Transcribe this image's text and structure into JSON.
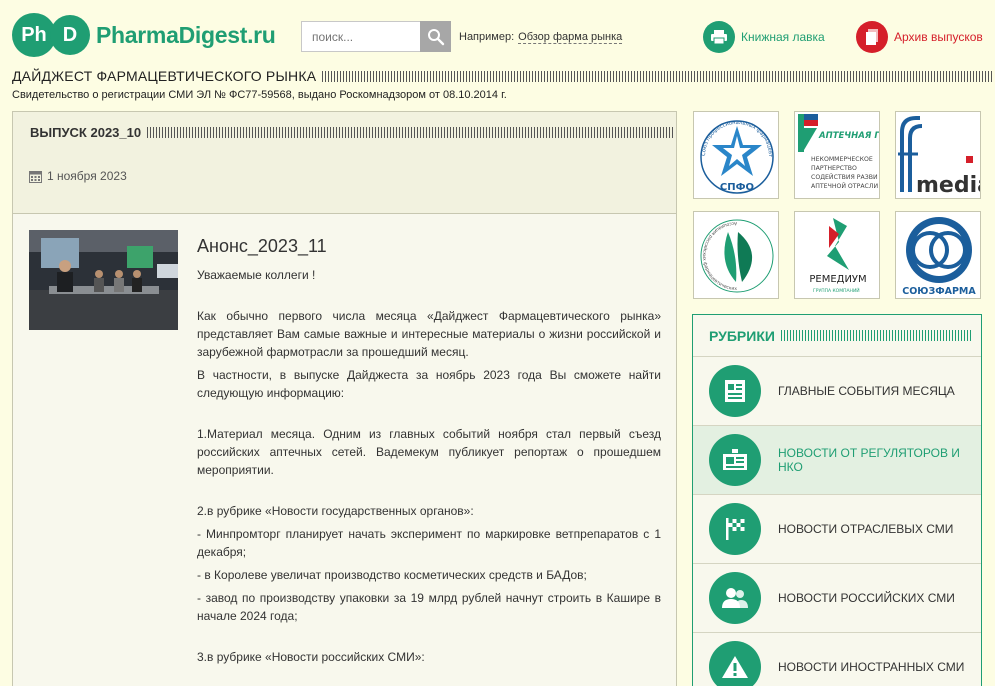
{
  "header": {
    "logo_ph": "Ph",
    "logo_d": "D",
    "site_name": "PharmaDigest.ru",
    "search_placeholder": "поиск...",
    "example_prefix": "Например:",
    "example_link": "Обзор фарма рынка",
    "books_label": "Книжная лавка",
    "archive_label": "Архив выпусков"
  },
  "site": {
    "title": "ДАЙДЖЕСТ ФАРМАЦЕВТИЧЕСКОГО РЫНКА",
    "registration": "Свидетельство о регистрации СМИ ЭЛ № ФС77-59568, выдано Роскомнадзором от 08.10.2014 г."
  },
  "issue": {
    "title": "ВЫПУСК 2023_10",
    "date": "1 ноября 2023"
  },
  "article": {
    "title": "Анонс_2023_11",
    "greeting": "Уважаемые коллеги !",
    "p1": "Как обычно первого числа месяца «Дайджест Фармацевтического рынка» представляет Вам самые важные и интересные материалы о жизни российской и зарубежной фармотрасли за прошедший месяц.",
    "p2": "В частности, в выпуске Дайджеста за ноябрь 2023 года Вы сможете найти следующую информацию:",
    "p3": "1.Материал месяца. Одним из главных событий ноября стал первый съезд российских аптечных сетей. Вадемекум публикует репортаж о прошедшем мероприятии.",
    "p4": "2.в рубрике «Новости государственных органов»:",
    "p5": "- Минпромторг планирует начать эксперимент по маркировке ветпрепаратов с 1 декабря;",
    "p6": "- в Королеве увеличат производство косметических средств и БАДов;",
    "p7": "- завод по производству упаковки за 19 млрд рублей начнут строить в Кашире в начале 2024 года;",
    "p8": "3.в рубрике «Новости российских СМИ»:"
  },
  "partners": {
    "spfo_arc": "Союз профессиональных фармацевтических организаций",
    "spfo_label": "СПФО",
    "guild_title": "АПТЕЧНАЯ ГИЛЬДИЯ",
    "guild_sub1": "НЕКОММЕРЧЕСКОЕ",
    "guild_sub2": "ПАРТНЕРСТВО",
    "guild_sub3": "СОДЕЙСТВИЯ РАЗВИ",
    "guild_sub4": "АПТЕЧНОЙ ОТРАСЛИ",
    "media_label": "media",
    "assoc_arc": "Ассоциация российских фармацевтических производителей",
    "remedium_label": "РЕМЕДИУМ",
    "remedium_sub": "ГРУППА КОМПАНИЙ",
    "soyuz_label": "СОЮЗФАРМА"
  },
  "rubrics": {
    "title": "РУБРИКИ",
    "items": [
      {
        "label": "ГЛАВНЫЕ СОБЫТИЯ МЕСЯЦА"
      },
      {
        "label": "НОВОСТИ ОТ РЕГУЛЯТОРОВ И НКО"
      },
      {
        "label": "НОВОСТИ ОТРАСЛЕВЫХ СМИ"
      },
      {
        "label": "НОВОСТИ РОССИЙСКИХ СМИ"
      },
      {
        "label": "НОВОСТИ ИНОСТРАННЫХ СМИ"
      }
    ]
  },
  "colors": {
    "brand_green": "#1f9e73",
    "archive_red": "#d51f2a",
    "page_bg": "#fdfde3"
  }
}
